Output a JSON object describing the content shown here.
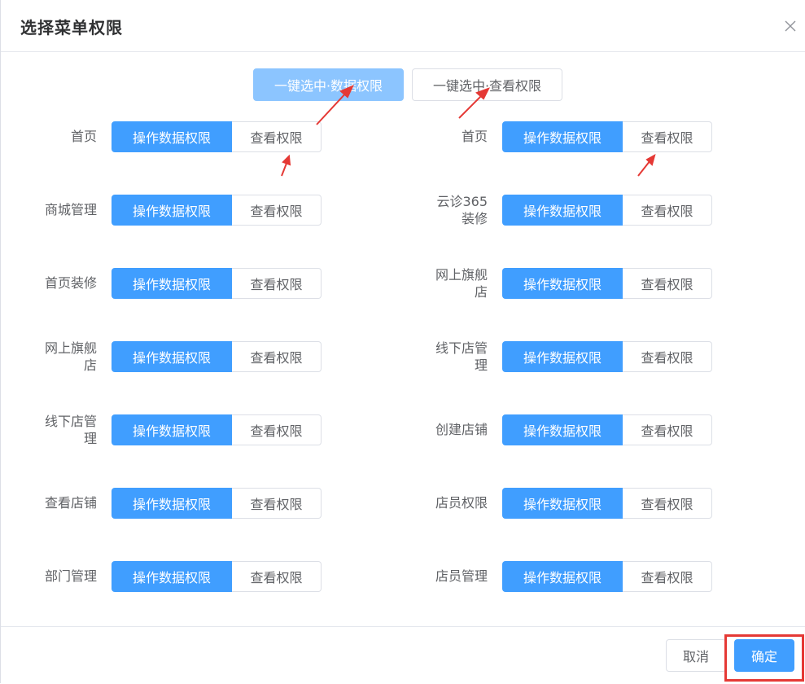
{
  "dialog": {
    "title": "选择菜单权限",
    "close_icon": "close-icon"
  },
  "quick_actions": {
    "select_all_data": "一键选中·数据权限",
    "select_all_view": "一键选中·查看权限"
  },
  "permission_options": {
    "data": "操作数据权限",
    "view": "查看权限"
  },
  "left_column": [
    {
      "label": "首页",
      "selected": "操作数据权限"
    },
    {
      "label": "商城管理",
      "selected": "操作数据权限"
    },
    {
      "label": "首页装修",
      "selected": "操作数据权限"
    },
    {
      "label": "网上旗舰店",
      "selected": "操作数据权限"
    },
    {
      "label": "线下店管理",
      "selected": "操作数据权限"
    },
    {
      "label": "查看店铺",
      "selected": "操作数据权限"
    },
    {
      "label": "部门管理",
      "selected": "操作数据权限"
    }
  ],
  "right_column": [
    {
      "label": "首页",
      "selected": "操作数据权限"
    },
    {
      "label": "云诊365装修",
      "selected": "操作数据权限"
    },
    {
      "label": "网上旗舰店",
      "selected": "操作数据权限"
    },
    {
      "label": "线下店管理",
      "selected": "操作数据权限"
    },
    {
      "label": "创建店铺",
      "selected": "操作数据权限"
    },
    {
      "label": "店员权限",
      "selected": "操作数据权限"
    },
    {
      "label": "店员管理",
      "selected": "操作数据权限"
    }
  ],
  "footer": {
    "cancel_label": "取消",
    "confirm_label": "确定"
  },
  "colors": {
    "primary": "#409eff",
    "primary_light": "#8cc5ff",
    "annotation_red": "#e53935"
  }
}
